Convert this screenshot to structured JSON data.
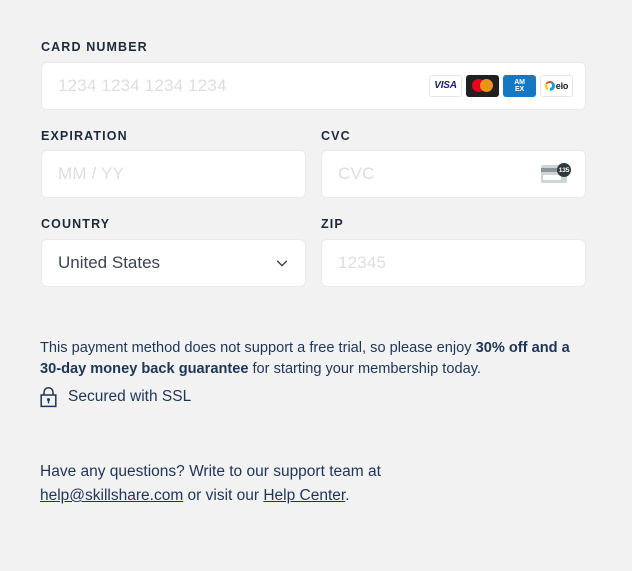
{
  "form": {
    "card_number": {
      "label": "CARD NUMBER",
      "placeholder": "1234 1234 1234 1234",
      "brands": [
        {
          "name": "visa",
          "text": "VISA"
        },
        {
          "name": "mastercard",
          "text": ""
        },
        {
          "name": "amex",
          "line1": "AM",
          "line2": "EX"
        },
        {
          "name": "elo",
          "text": "elo"
        }
      ]
    },
    "expiration": {
      "label": "EXPIRATION",
      "placeholder": "MM / YY"
    },
    "cvc": {
      "label": "CVC",
      "placeholder": "CVC",
      "icon_badge": "135"
    },
    "country": {
      "label": "COUNTRY",
      "value": "United States"
    },
    "zip": {
      "label": "ZIP",
      "placeholder": "12345"
    }
  },
  "notes": {
    "trial_note_part1": "This payment method does not support a free trial, so please enjoy ",
    "trial_note_bold": "30% off and a 30-day money back guarantee",
    "trial_note_part2": " for starting your membership today.",
    "ssl_text": "Secured with SSL"
  },
  "support": {
    "line_part1": "Have any questions? Write to our support team at ",
    "email": "help@skillshare.com",
    "line_part2": " or visit our ",
    "help_center": "Help Center",
    "line_part3": "."
  },
  "colors": {
    "background": "#f2f2f2",
    "text": "#1d3557",
    "label": "#1d2a3b",
    "placeholder": "#dcdee1",
    "input_bg": "#ffffff",
    "input_border": "#e9eaec",
    "visa_blue": "#1a1f71",
    "mc_red": "#eb001b",
    "mc_yellow": "#f79e1b",
    "amex_blue": "#1379c4"
  }
}
